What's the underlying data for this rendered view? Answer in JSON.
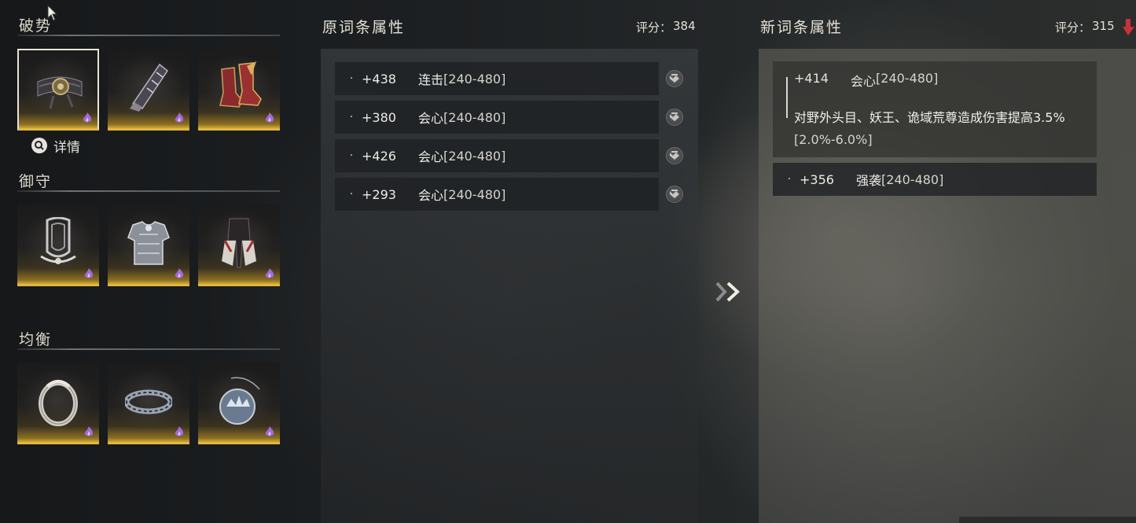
{
  "groups": [
    {
      "title": "破势",
      "slots": [
        {
          "item": "belt-icon",
          "rank": "purple-flame-icon"
        },
        {
          "item": "bracer-icon",
          "rank": "purple-flame-icon"
        },
        {
          "item": "boots-icon",
          "rank": "purple-flame-icon"
        }
      ]
    },
    {
      "title": "御守",
      "slots": [
        {
          "item": "headgear-icon",
          "rank": "purple-flame-icon"
        },
        {
          "item": "chest-armor-icon",
          "rank": "purple-flame-icon"
        },
        {
          "item": "leg-armor-icon",
          "rank": "purple-flame-icon"
        }
      ]
    },
    {
      "title": "均衡",
      "slots": [
        {
          "item": "ring-icon",
          "rank": "purple-flame-icon"
        },
        {
          "item": "bracelet-icon",
          "rank": "purple-flame-icon"
        },
        {
          "item": "pendant-icon",
          "rank": "purple-flame-icon"
        }
      ]
    }
  ],
  "detail_label": "详情",
  "original": {
    "title": "原词条属性",
    "score_label": "评分：",
    "score": "384",
    "rows": [
      {
        "bullet": "·",
        "value": "+438",
        "attr": "连击",
        "range": "[240-480]"
      },
      {
        "bullet": "·",
        "value": "+380",
        "attr": "会心",
        "range": "[240-480]"
      },
      {
        "bullet": "·",
        "value": "+426",
        "attr": "会心",
        "range": "[240-480]"
      },
      {
        "bullet": "·",
        "value": "+293",
        "attr": "会心",
        "range": "[240-480]"
      }
    ]
  },
  "new": {
    "title": "新词条属性",
    "score_label": "评分：",
    "score": "315",
    "score_trend": "down",
    "block": {
      "value": "+414",
      "attr": "会心",
      "range": "[240-480]",
      "desc": "对野外头目、妖王、诡域荒尊造成伤害提高3.5%",
      "desc_range": "[2.0%-6.0%]"
    },
    "rows": [
      {
        "bullet": "·",
        "value": "+356",
        "attr": "强袭",
        "range": "[240-480]"
      }
    ]
  },
  "colors": {
    "gold": "#e0b640",
    "purple": "#a06ad8",
    "down_arrow": "#c8323a",
    "arrow": "#f0ede4"
  }
}
